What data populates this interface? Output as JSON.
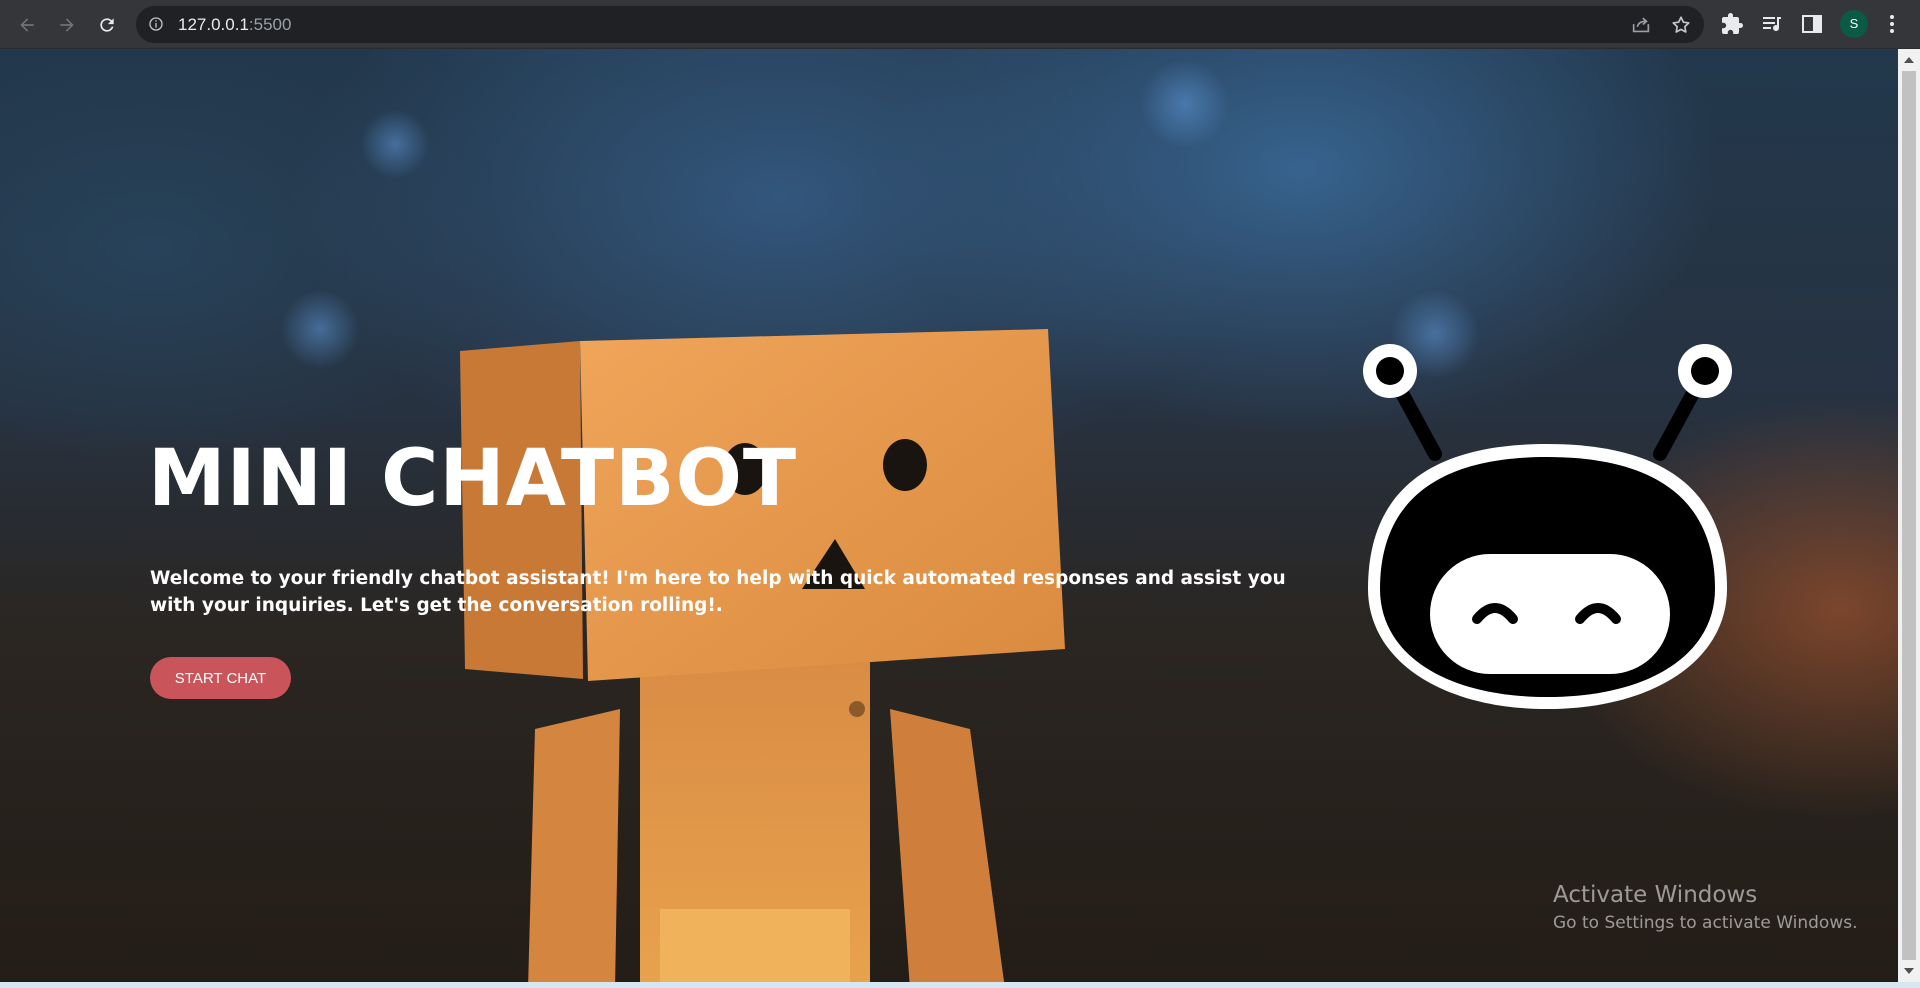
{
  "browser": {
    "url_host": "127.0.0.1",
    "url_port": ":5500",
    "profile_initial": "S",
    "icons": [
      "back-arrow-icon",
      "forward-arrow-icon",
      "reload-icon",
      "info-icon",
      "share-icon",
      "star-icon",
      "extensions-icon",
      "media-queue-icon",
      "side-panel-icon",
      "kebab-menu-icon"
    ]
  },
  "hero": {
    "title": "MINI CHATBOT",
    "description": "Welcome to your friendly chatbot assistant! I'm here to help with quick automated responses and assist you with your inquiries. Let's get the conversation rolling!.",
    "start_button": "START CHAT"
  },
  "watermark": {
    "line1": "Activate Windows",
    "line2": "Go to Settings to activate Windows."
  },
  "colors": {
    "accent_button": "#c9555b",
    "toolbar": "#35363a",
    "omnibox": "#202124",
    "avatar": "#0b5a46"
  }
}
